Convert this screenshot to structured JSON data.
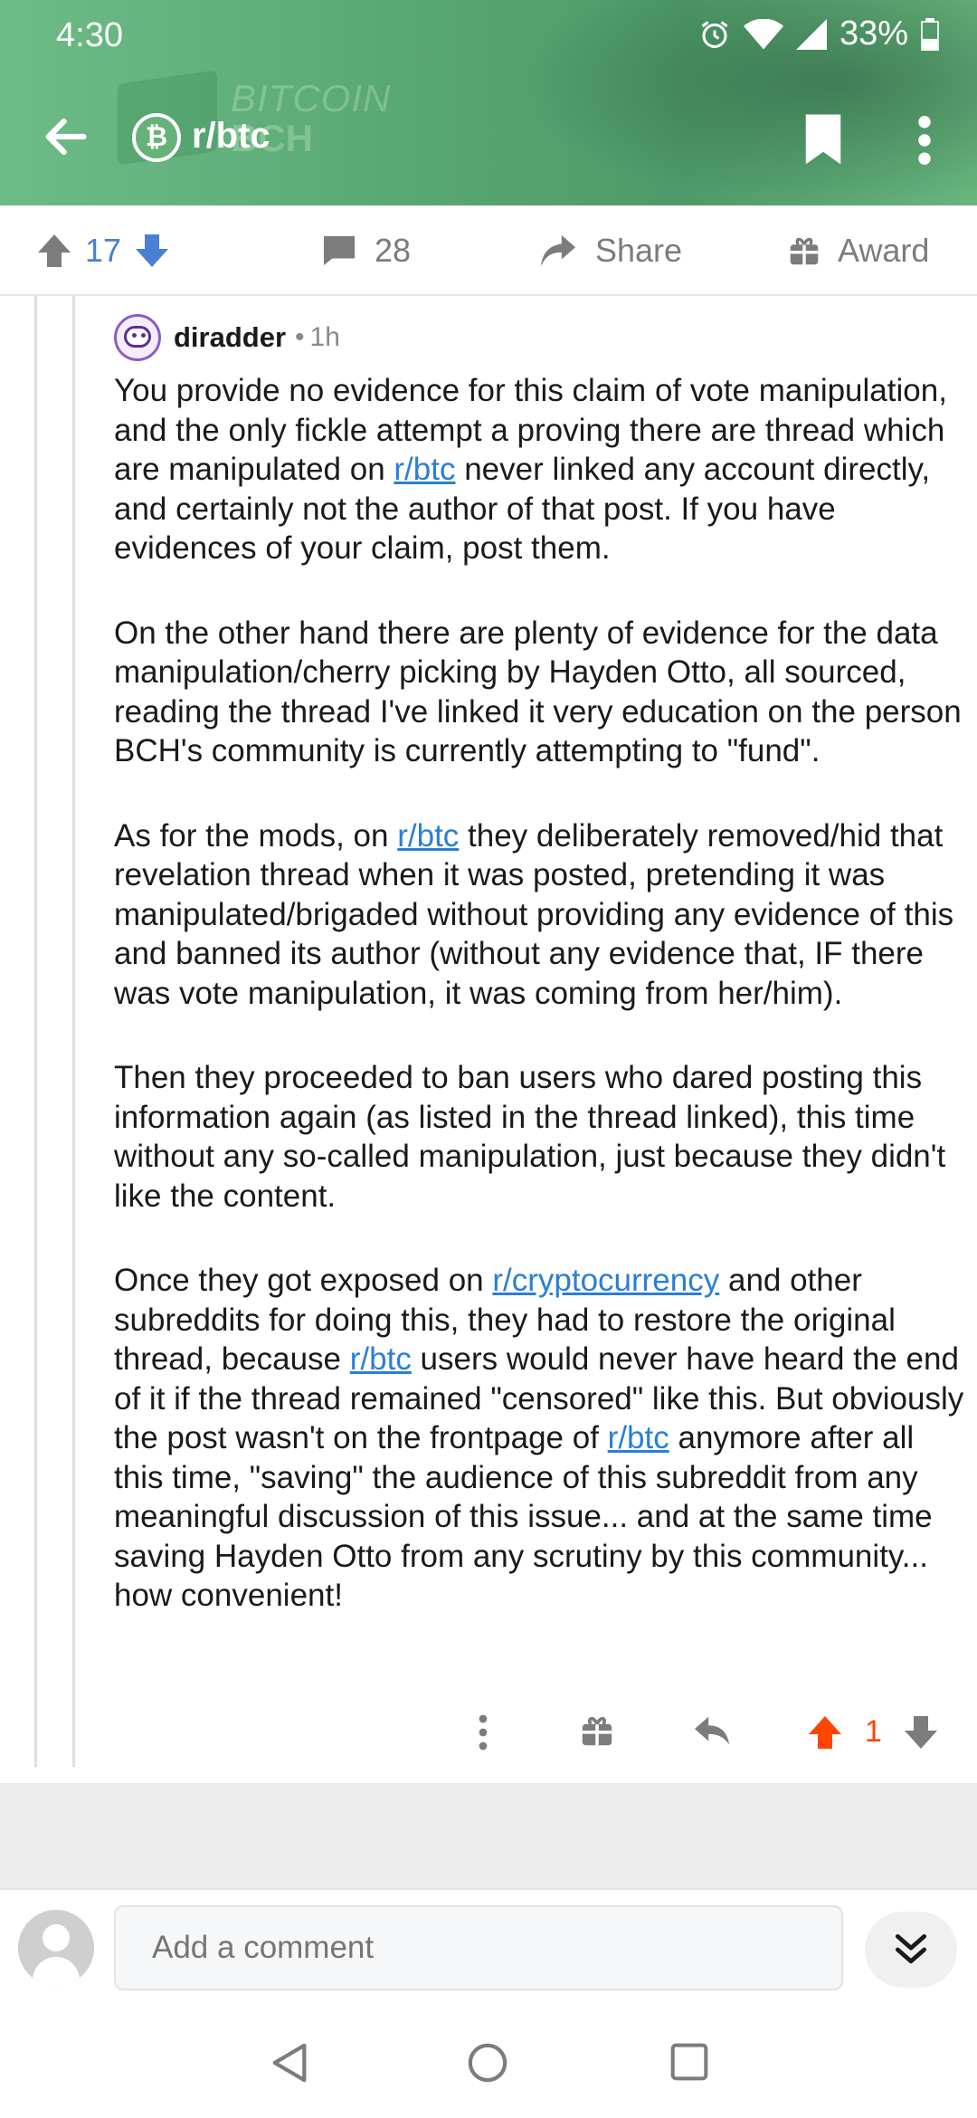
{
  "status_bar": {
    "time": "4:30",
    "battery": "33%",
    "icons": [
      "alarm-icon",
      "wifi-icon",
      "signal-icon",
      "battery-icon"
    ]
  },
  "header": {
    "subreddit": "r/btc",
    "banner_text_1": "BITCOIN",
    "banner_text_2": "BCH",
    "accent_color": "#5aa874"
  },
  "post_actions": {
    "vote_count": "17",
    "comment_count": "28",
    "share_label": "Share",
    "award_label": "Award"
  },
  "comment": {
    "author": "diradder",
    "separator": "•",
    "age": "1h",
    "p1": {
      "t1": "You provide no evidence for this claim of vote manipulation, and the only fickle attempt a proving there are thread which are manipulated on ",
      "link1": "r/btc",
      "t2": " never linked any account directly, and certainly not the author of that post. If you have evidences of your claim, post them."
    },
    "p2": "On the other hand there are plenty of evidence for the data manipulation/cherry picking by Hayden Otto, all sourced, reading the thread I've linked it very education on the person BCH's community is currently attempting to \"fund\".",
    "p3": {
      "t1": "As for the mods, on ",
      "link1": "r/btc",
      "t2": " they deliberately removed/hid that revelation thread when it was posted, pretending it was manipulated/brigaded without providing any evidence of this and banned its author (without any evidence that, IF there was vote manipulation, it was coming from her/him)."
    },
    "p4": "Then they proceeded to ban users who dared posting this information again (as listed in the thread linked), this time without any so-called manipulation, just because they didn't like the content.",
    "p5": {
      "t1": "Once they got exposed on ",
      "link1": "r/cryptocurrency",
      "t2": " and other subreddits for doing this, they had to restore the original thread, because ",
      "link2": "r/btc",
      "t3": " users would never have heard the end of it if the thread remained \"censored\" like this. But obviously the post wasn't on the frontpage of ",
      "link3": "r/btc",
      "t4": " anymore after all this time, \"saving\" the audience of this subreddit from any meaningful discussion of this issue... and at the same time saving Hayden Otto from any scrutiny by this community... how convenient!"
    },
    "vote_count": "1",
    "upvote_color": "#ff4500"
  },
  "bottom_bar": {
    "comment_placeholder": "Add a comment"
  },
  "system_nav": [
    "back-icon",
    "home-icon",
    "recents-icon"
  ]
}
